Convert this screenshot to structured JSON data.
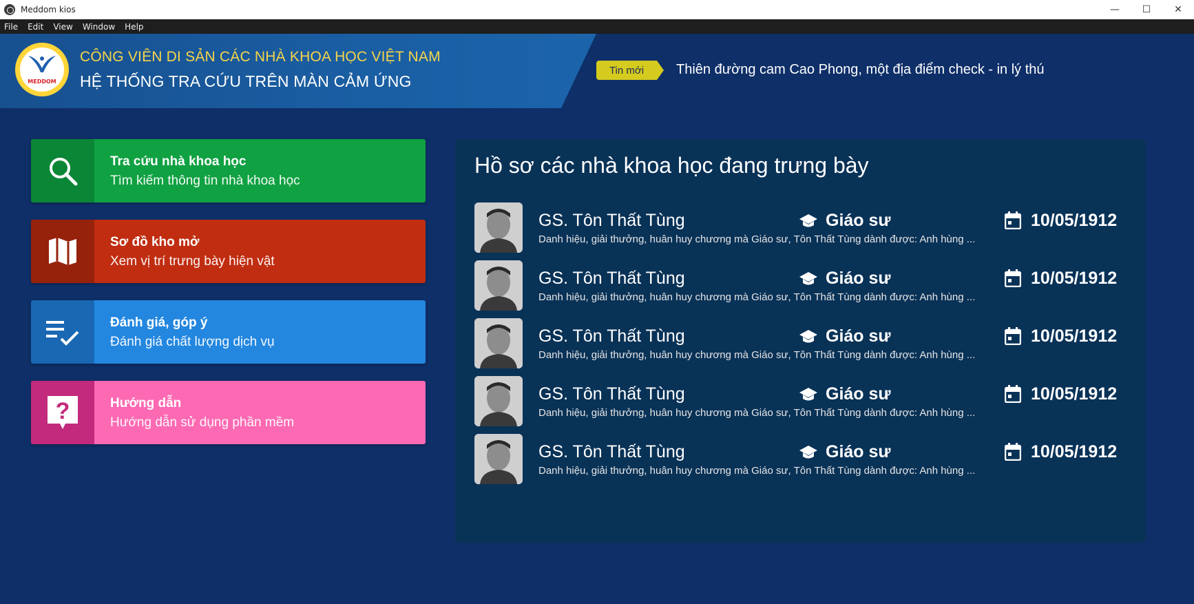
{
  "window": {
    "title": "Meddom kios",
    "controls": {
      "minimize": "—",
      "maximize": "☐",
      "close": "✕"
    }
  },
  "menubar": {
    "items": [
      "File",
      "Edit",
      "View",
      "Window",
      "Help"
    ]
  },
  "header": {
    "logo_text": "MEDDOM",
    "line1": "CÔNG VIÊN DI SẢN CÁC NHÀ KHOA HỌC VIỆT NAM",
    "line2": "HỆ THỐNG TRA CỨU TRÊN MÀN CẢM ỨNG",
    "news_tag": "Tin mới",
    "news_text": "Thiên đường cam Cao Phong, một địa điểm check - in lý thú"
  },
  "menu_cards": [
    {
      "title": "Tra cứu nhà khoa học",
      "subtitle": "Tìm kiếm thông tin nhà khoa học",
      "icon": "search-icon",
      "color": "#10a142"
    },
    {
      "title": "Sơ đồ kho mở",
      "subtitle": "Xem vị trí trưng bày hiện vật",
      "icon": "map-icon",
      "color": "#c02d11"
    },
    {
      "title": "Đánh giá, góp ý",
      "subtitle": "Đánh giá chất lượng dịch vụ",
      "icon": "checklist-icon",
      "color": "#2387e0"
    },
    {
      "title": "Hướng dẫn",
      "subtitle": "Hướng dẫn sử dụng phần mềm",
      "icon": "question-icon",
      "color": "#fd69b3"
    }
  ],
  "panel": {
    "title": "Hồ sơ các nhà khoa học đang trưng bày",
    "rows": [
      {
        "name": "GS. Tôn Thất Tùng",
        "rank": "Giáo sư",
        "date": "10/05/1912",
        "description": "Danh hiệu, giải thưởng, huân huy chương mà Giáo sư, Tôn Thất Tùng dành được: Anh hùng ..."
      },
      {
        "name": "GS. Tôn Thất Tùng",
        "rank": "Giáo sư",
        "date": "10/05/1912",
        "description": "Danh hiệu, giải thưởng, huân huy chương mà Giáo sư, Tôn Thất Tùng dành được: Anh hùng ..."
      },
      {
        "name": "GS. Tôn Thất Tùng",
        "rank": "Giáo sư",
        "date": "10/05/1912",
        "description": "Danh hiệu, giải thưởng, huân huy chương mà Giáo sư, Tôn Thất Tùng dành được: Anh hùng ..."
      },
      {
        "name": "GS. Tôn Thất Tùng",
        "rank": "Giáo sư",
        "date": "10/05/1912",
        "description": "Danh hiệu, giải thưởng, huân huy chương mà Giáo sư, Tôn Thất Tùng dành được: Anh hùng ..."
      },
      {
        "name": "GS. Tôn Thất Tùng",
        "rank": "Giáo sư",
        "date": "10/05/1912",
        "description": "Danh hiệu, giải thưởng, huân huy chương mà Giáo sư, Tôn Thất Tùng dành được: Anh hùng ..."
      }
    ]
  },
  "colors": {
    "background": "#0f2f68",
    "panel": "#093257",
    "header_accent": "#f6d54a",
    "news_tag": "#d5cb1e"
  }
}
